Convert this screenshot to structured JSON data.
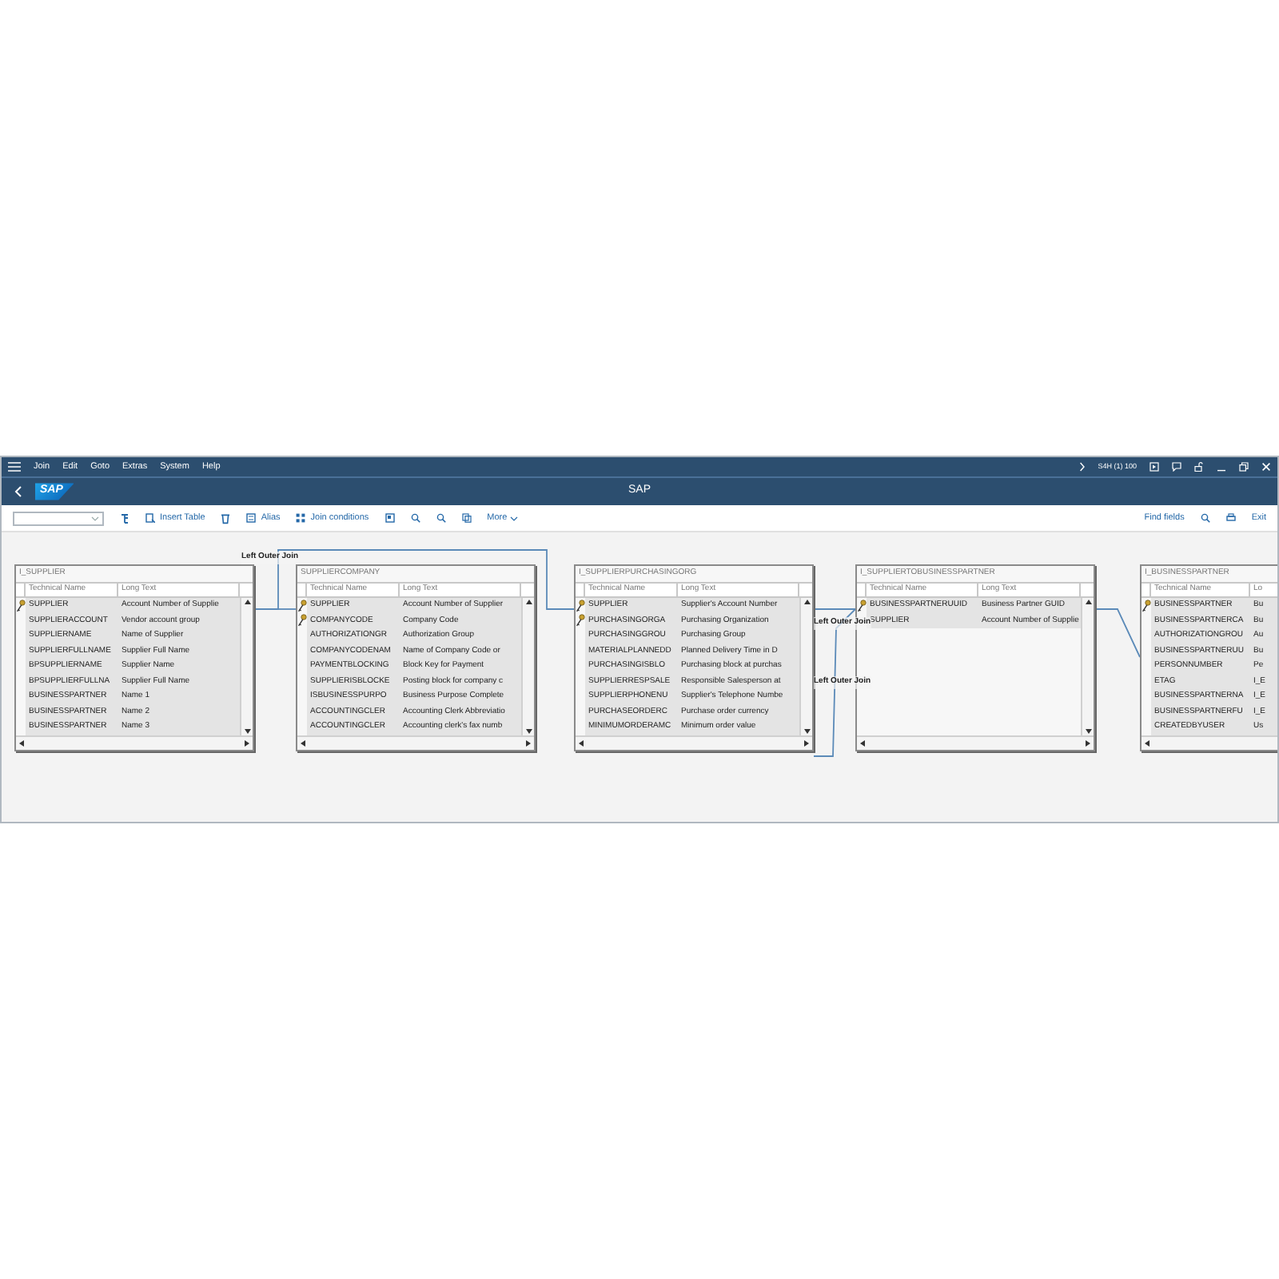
{
  "menu": [
    "Join",
    "Edit",
    "Goto",
    "Extras",
    "System",
    "Help"
  ],
  "system_info": "S4H (1) 100",
  "window": {
    "title": "SAP",
    "logo": "SAP"
  },
  "toolbar": {
    "buttons": [
      "Insert Table",
      "Alias",
      "Join conditions"
    ],
    "more": "More",
    "find": "Find fields",
    "exit": "Exit"
  },
  "tables": [
    {
      "name": "I_SUPPLIER",
      "columns": [
        "Technical Name",
        "Long Text"
      ],
      "rows": [
        {
          "field": "SUPPLIER",
          "text": "Account Number of Supplie",
          "key": true
        },
        {
          "field": "SUPPLIERACCOUNT",
          "text": "Vendor account group",
          "key": false
        },
        {
          "field": "SUPPLIERNAME",
          "text": "Name of Supplier",
          "key": false
        },
        {
          "field": "SUPPLIERFULLNAME",
          "text": "Supplier Full Name",
          "key": false
        },
        {
          "field": "BPSUPPLIERNAME",
          "text": "Supplier Name",
          "key": false
        },
        {
          "field": "BPSUPPLIERFULLNA",
          "text": "Supplier Full Name",
          "key": false
        },
        {
          "field": "BUSINESSPARTNER",
          "text": "Name 1",
          "key": false
        },
        {
          "field": "BUSINESSPARTNER",
          "text": "Name 2",
          "key": false
        },
        {
          "field": "BUSINESSPARTNER",
          "text": "Name 3",
          "key": false
        }
      ]
    },
    {
      "name": "SUPPLIERCOMPANY",
      "columns": [
        "Technical Name",
        "Long Text"
      ],
      "rows": [
        {
          "field": "SUPPLIER",
          "text": "Account Number of Supplier",
          "key": true
        },
        {
          "field": "COMPANYCODE",
          "text": "Company Code",
          "key": true
        },
        {
          "field": "AUTHORIZATIONGR",
          "text": "Authorization Group",
          "key": false
        },
        {
          "field": "COMPANYCODENAM",
          "text": "Name of Company Code or",
          "key": false
        },
        {
          "field": "PAYMENTBLOCKING",
          "text": "Block Key for Payment",
          "key": false
        },
        {
          "field": "SUPPLIERISBLOCKE",
          "text": "Posting block for company c",
          "key": false
        },
        {
          "field": "ISBUSINESSPURPO",
          "text": "Business Purpose Complete",
          "key": false
        },
        {
          "field": "ACCOUNTINGCLER",
          "text": "Accounting Clerk Abbreviatio",
          "key": false
        },
        {
          "field": "ACCOUNTINGCLER",
          "text": "Accounting clerk's fax numb",
          "key": false
        }
      ]
    },
    {
      "name": "I_SUPPLIERPURCHASINGORG",
      "columns": [
        "Technical Name",
        "Long Text"
      ],
      "rows": [
        {
          "field": "SUPPLIER",
          "text": "Supplier's Account Number",
          "key": true
        },
        {
          "field": "PURCHASINGORGA",
          "text": "Purchasing Organization",
          "key": true
        },
        {
          "field": "PURCHASINGGROU",
          "text": "Purchasing Group",
          "key": false
        },
        {
          "field": "MATERIALPLANNEDD",
          "text": "Planned Delivery Time in D",
          "key": false
        },
        {
          "field": "PURCHASINGISBLO",
          "text": "Purchasing block at purchas",
          "key": false
        },
        {
          "field": "SUPPLIERRESPSALE",
          "text": "Responsible Salesperson at",
          "key": false
        },
        {
          "field": "SUPPLIERPHONENU",
          "text": "Supplier's Telephone Numbe",
          "key": false
        },
        {
          "field": "PURCHASEORDERC",
          "text": "Purchase order currency",
          "key": false
        },
        {
          "field": "MINIMUMORDERAMC",
          "text": "Minimum order value",
          "key": false
        }
      ]
    },
    {
      "name": "I_SUPPLIERTOBUSINESSPARTNER",
      "columns": [
        "Technical Name",
        "Long Text"
      ],
      "rows": [
        {
          "field": "BUSINESSPARTNERUUID",
          "text": "Business Partner GUID",
          "key": true
        },
        {
          "field": "SUPPLIER",
          "text": "Account Number of Supplie",
          "key": false
        }
      ]
    },
    {
      "name": "I_BUSINESSPARTNER",
      "columns": [
        "Technical Name",
        "Lo"
      ],
      "rows": [
        {
          "field": "BUSINESSPARTNER",
          "text": "Bu",
          "key": true
        },
        {
          "field": "BUSINESSPARTNERCA",
          "text": "Bu",
          "key": false
        },
        {
          "field": "AUTHORIZATIONGROU",
          "text": "Au",
          "key": false
        },
        {
          "field": "BUSINESSPARTNERUU",
          "text": "Bu",
          "key": false
        },
        {
          "field": "PERSONNUMBER",
          "text": "Pe",
          "key": false
        },
        {
          "field": "ETAG",
          "text": "I_E",
          "key": false
        },
        {
          "field": "BUSINESSPARTNERNA",
          "text": "I_E",
          "key": false
        },
        {
          "field": "BUSINESSPARTNERFU",
          "text": "I_E",
          "key": false
        },
        {
          "field": "CREATEDBYUSER",
          "text": "Us",
          "key": false
        }
      ]
    }
  ],
  "joins": [
    "Left Outer Join",
    "Left Outer Join",
    "Left Outer Join"
  ]
}
